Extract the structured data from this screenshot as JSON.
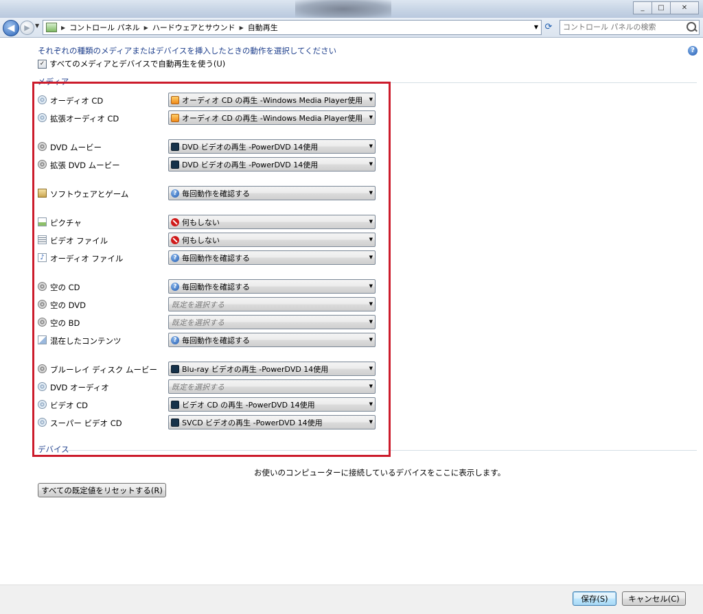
{
  "window": {
    "buttons": [
      "_",
      "□",
      "✕"
    ]
  },
  "nav": {
    "breadcrumb": [
      "コントロール パネル",
      "ハードウェアとサウンド",
      "自動再生"
    ],
    "search_placeholder": "コントロール パネルの検索"
  },
  "page": {
    "instruction": "それぞれの種類のメディアまたはデバイスを挿入したときの動作を選択してください",
    "use_autoplay_label": "すべてのメディアとデバイスで自動再生を使う(U)",
    "use_autoplay_checked": true,
    "media_heading": "メディア",
    "devices_heading": "デバイス",
    "devices_note": "お使いのコンピューターに接続しているデバイスをここに表示します。",
    "reset_button": "すべての既定値をリセットする(R)",
    "save_button": "保存(S)",
    "cancel_button": "キャンセル(C)"
  },
  "media": [
    {
      "label": "オーディオ CD",
      "icon": "audio-cd-icon",
      "value": "オーディオ CD の再生 -Windows Media Player使用",
      "value_icon": "windows-media-player-icon"
    },
    {
      "label": "拡張オーディオ CD",
      "icon": "enhanced-audio-cd-icon",
      "value": "オーディオ CD の再生 -Windows Media Player使用",
      "value_icon": "windows-media-player-icon"
    },
    {
      "label": "DVD ムービー",
      "icon": "dvd-movie-icon",
      "value": "DVD ビデオの再生 -PowerDVD 14使用",
      "value_icon": "powerdvd-icon"
    },
    {
      "label": "拡張 DVD ムービー",
      "icon": "enhanced-dvd-movie-icon",
      "value": "DVD ビデオの再生 -PowerDVD 14使用",
      "value_icon": "powerdvd-icon"
    },
    {
      "label": "ソフトウェアとゲーム",
      "icon": "software-games-icon",
      "value": "毎回動作を確認する",
      "value_icon": "ask-every-time-icon"
    },
    {
      "label": "ピクチャ",
      "icon": "pictures-icon",
      "value": "何もしない",
      "value_icon": "take-no-action-icon"
    },
    {
      "label": "ビデオ ファイル",
      "icon": "video-files-icon",
      "value": "何もしない",
      "value_icon": "take-no-action-icon"
    },
    {
      "label": "オーディオ ファイル",
      "icon": "audio-files-icon",
      "value": "毎回動作を確認する",
      "value_icon": "ask-every-time-icon"
    },
    {
      "label": "空の CD",
      "icon": "blank-cd-icon",
      "value": "毎回動作を確認する",
      "value_icon": "ask-every-time-icon"
    },
    {
      "label": "空の DVD",
      "icon": "blank-dvd-icon",
      "value": "既定を選択する",
      "value_icon": "",
      "placeholder": true
    },
    {
      "label": "空の BD",
      "icon": "blank-bd-icon",
      "value": "既定を選択する",
      "value_icon": "",
      "placeholder": true
    },
    {
      "label": "混在したコンテンツ",
      "icon": "mixed-content-icon",
      "value": "毎回動作を確認する",
      "value_icon": "ask-every-time-icon"
    },
    {
      "label": "ブルーレイ ディスク ムービー",
      "icon": "bluray-movie-icon",
      "value": "Blu-ray ビデオの再生 -PowerDVD 14使用",
      "value_icon": "powerdvd-icon"
    },
    {
      "label": "DVD オーディオ",
      "icon": "dvd-audio-icon",
      "value": "既定を選択する",
      "value_icon": "",
      "placeholder": true
    },
    {
      "label": "ビデオ CD",
      "icon": "video-cd-icon",
      "value": "ビデオ CD の再生 -PowerDVD 14使用",
      "value_icon": "powerdvd-icon"
    },
    {
      "label": "スーパー ビデオ CD",
      "icon": "super-video-cd-icon",
      "value": "SVCD ビデオの再生 -PowerDVD 14使用",
      "value_icon": "powerdvd-icon"
    }
  ],
  "colors": {
    "highlight_box": "#cc1b2b",
    "heading_text": "#1e3f8c"
  }
}
